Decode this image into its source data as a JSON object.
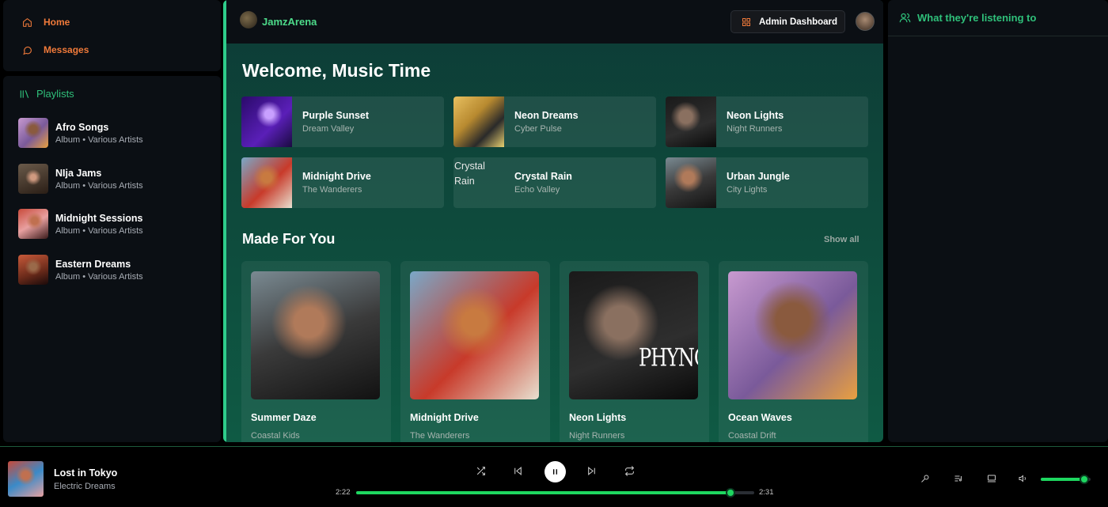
{
  "nav": {
    "home_label": "Home",
    "messages_label": "Messages"
  },
  "library": {
    "heading": "Playlists",
    "items": [
      {
        "title": "Afro Songs",
        "subtitle": "Album • Various Artists"
      },
      {
        "title": "NIja Jams",
        "subtitle": "Album • Various Artists"
      },
      {
        "title": "Midnight Sessions",
        "subtitle": "Album • Various Artists"
      },
      {
        "title": "Eastern Dreams",
        "subtitle": "Album • Various Artists"
      }
    ]
  },
  "header": {
    "brand": "JamzArena",
    "admin_button": "Admin Dashboard"
  },
  "main": {
    "welcome": "Welcome, Music Time",
    "quick_picks": [
      {
        "title": "Purple Sunset",
        "artist": "Dream Valley"
      },
      {
        "title": "Neon Dreams",
        "artist": "Cyber Pulse"
      },
      {
        "title": "Neon Lights",
        "artist": "Night Runners"
      },
      {
        "title": "Midnight Drive",
        "artist": "The Wanderers"
      },
      {
        "title": "Crystal Rain",
        "artist": "Echo Valley",
        "image_alt": "Crystal Rain"
      },
      {
        "title": "Urban Jungle",
        "artist": "City Lights"
      }
    ],
    "made_for_you": {
      "title": "Made For You",
      "show_all": "Show all",
      "cards": [
        {
          "title": "Summer Daze",
          "artist": "Coastal Kids"
        },
        {
          "title": "Midnight Drive",
          "artist": "The Wanderers"
        },
        {
          "title": "Neon Lights",
          "artist": "Night Runners",
          "cover_text": "PHYNO"
        },
        {
          "title": "Ocean Waves",
          "artist": "Coastal Drift"
        }
      ]
    }
  },
  "friends": {
    "heading": "What they're listening to"
  },
  "player": {
    "title": "Lost in Tokyo",
    "artist": "Electric Dreams",
    "elapsed": "2:22",
    "duration": "2:31",
    "progress_fraction": 0.94,
    "volume_fraction": 0.87,
    "accent": "#1ed760"
  }
}
